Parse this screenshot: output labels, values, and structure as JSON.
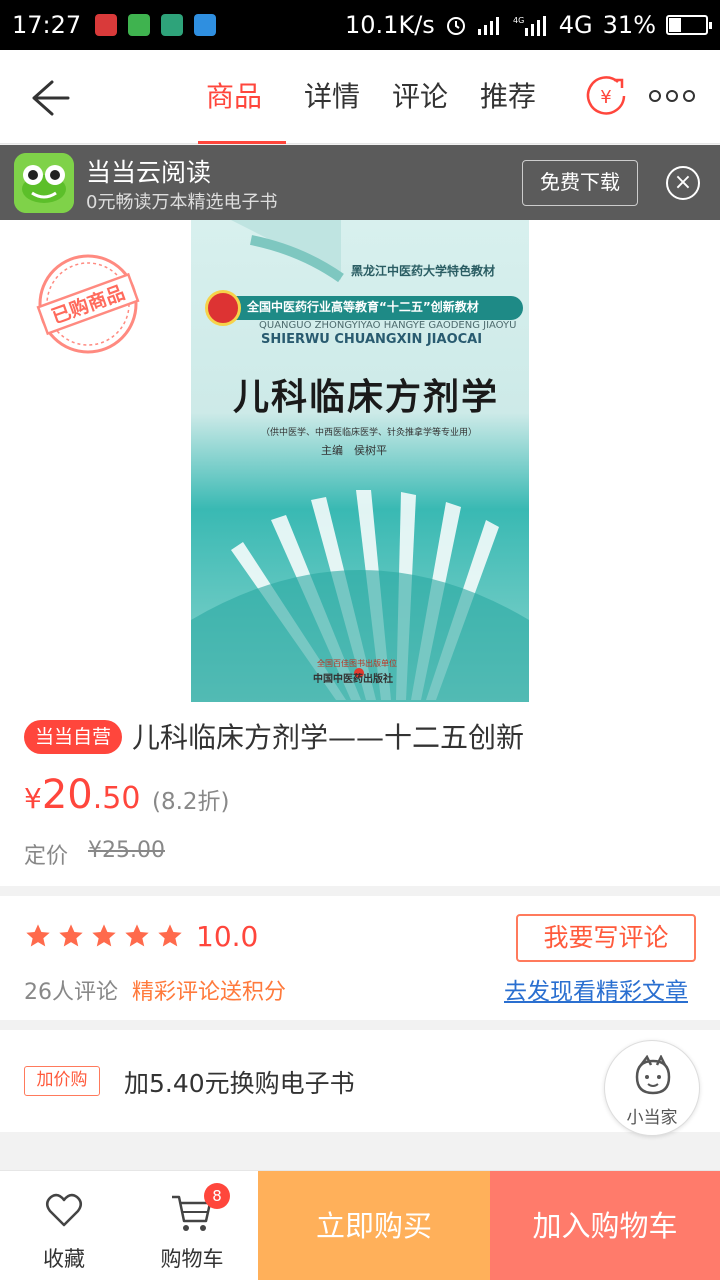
{
  "status_bar": {
    "time": "17:27",
    "network_speed": "10.1K/s",
    "network_type": "4G",
    "battery": "31%",
    "battery_level": 0.31
  },
  "nav": {
    "tabs": [
      {
        "label": "商品",
        "active": true
      },
      {
        "label": "详情",
        "active": false
      },
      {
        "label": "评论",
        "active": false
      },
      {
        "label": "推荐",
        "active": false
      }
    ],
    "accent_color": "#ff463c"
  },
  "banner": {
    "title": "当当云阅读",
    "subtitle": "0元畅读万本精选电子书",
    "download_label": "免费下载",
    "close_glyph": "×"
  },
  "product_image": {
    "stamp_text": "已购商品",
    "cover": {
      "series": "黑龙江中医药大学特色教材",
      "band": "全国中医药行业高等教育“十二五”创新教材",
      "pinyin_line1": "QUANGUO ZHONGYIYAO HANGYE GAODENG JIAOYU",
      "pinyin_line2": "SHIERWU CHUANGXIN JIAOCAI",
      "title": "儿科临床方剂学",
      "note": "（供中医学、中西医临床医学、针灸推拿学等专业用）",
      "editor": "主编　侯树平",
      "publisher_top": "全国百佳图书出版单位",
      "publisher": "中国中医药出版社"
    }
  },
  "product": {
    "tag": "当当自营",
    "title": "儿科临床方剂学——十二五创新",
    "price_symbol": "¥",
    "price_int": "20",
    "price_dec": ".50",
    "discount": "(8.2折)",
    "list_price_label": "定价",
    "list_price": "¥25.00"
  },
  "rating": {
    "stars": 5,
    "score": "10.0",
    "review_count": "26人评论",
    "promo": "精彩评论送积分",
    "write_review": "我要写评论",
    "discover_link": "去发现看精彩文章"
  },
  "addon": {
    "tag": "加价购",
    "text": "加5.40元换购电子书"
  },
  "mascot": {
    "label": "小当家"
  },
  "bottom_bar": {
    "favorite_label": "收藏",
    "cart_label": "购物车",
    "cart_count": "8",
    "buy_now": "立即购买",
    "add_to_cart": "加入购物车"
  }
}
